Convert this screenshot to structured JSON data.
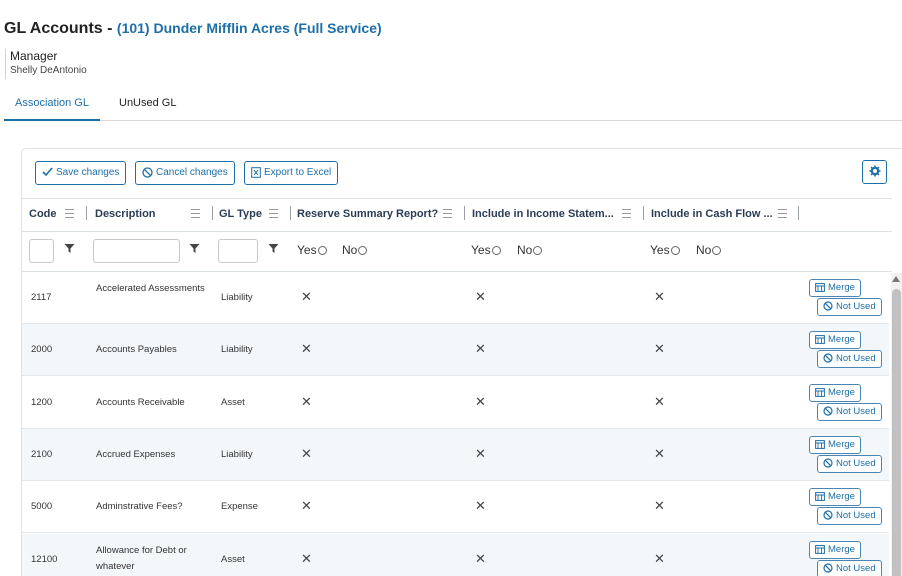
{
  "header": {
    "title": "GL Accounts -",
    "property": "(101) Dunder Mifflin Acres (Full Service)"
  },
  "manager": {
    "role": "Manager",
    "name": "Shelly DeAntonio"
  },
  "tabs": [
    {
      "label": "Association GL",
      "active": true
    },
    {
      "label": "UnUsed GL",
      "active": false
    }
  ],
  "toolbar": {
    "save_label": "Save changes",
    "cancel_label": "Cancel changes",
    "export_label": "Export to Excel"
  },
  "columns": {
    "code": "Code",
    "description": "Description",
    "gl_type": "GL Type",
    "reserve": "Reserve Summary Report?",
    "income": "Include in Income Statem...",
    "cashflow": "Include in Cash Flow ..."
  },
  "filters": {
    "yes": "Yes",
    "no": "No"
  },
  "row_buttons": {
    "merge": "Merge",
    "not_used": "Not Used"
  },
  "check_mark": "✕",
  "rows": [
    {
      "code": "2117",
      "description": "Accelerated Assessments",
      "type": "Liability"
    },
    {
      "code": "2000",
      "description": "Accounts Payables",
      "type": "Liability"
    },
    {
      "code": "1200",
      "description": "Accounts Receivable",
      "type": "Asset"
    },
    {
      "code": "2100",
      "description": "Accrued Expenses",
      "type": "Liability"
    },
    {
      "code": "5000",
      "description": "Adminstrative Fees?",
      "type": "Expense"
    },
    {
      "code": "12100",
      "description": "Allowance for Debt or whatever",
      "type": "Asset"
    }
  ],
  "colors": {
    "accent": "#1e6fa8",
    "row_alt": "#f4f7fa",
    "border": "#dde2e6"
  }
}
